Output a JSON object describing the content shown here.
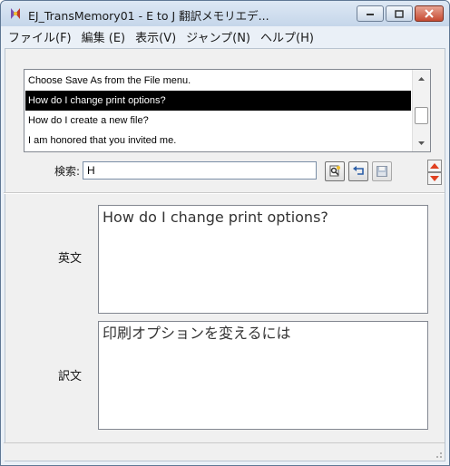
{
  "window": {
    "title": "EJ_TransMemory01 - E to J 翻訳メモリエデ...",
    "app_icon": "app-logo-icon"
  },
  "menu": [
    {
      "label": "ファイル(F)"
    },
    {
      "label": "編集 (E)"
    },
    {
      "label": "表示(V)"
    },
    {
      "label": "ジャンプ(N)"
    },
    {
      "label": "ヘルプ(H)"
    }
  ],
  "list": {
    "items": [
      {
        "text": "Choose Save As from the File menu."
      },
      {
        "text": "How do I change print options?"
      },
      {
        "text": "How do I create a new file?"
      },
      {
        "text": "I am honored that you invited me."
      }
    ],
    "selected_index": 1
  },
  "search": {
    "label": "検索:",
    "value": "H"
  },
  "toolbar": {
    "icons": [
      "find-icon",
      "undo-icon",
      "save-icon",
      "up-down-spin-icon"
    ]
  },
  "english": {
    "label": "英文",
    "text": "How do I change print options?"
  },
  "translation": {
    "label": "訳文",
    "text": "印刷オプションを変えるには"
  },
  "colors": {
    "selection_bg": "#000000",
    "selection_fg": "#ffffff",
    "spin_arrow": "#e04020"
  }
}
